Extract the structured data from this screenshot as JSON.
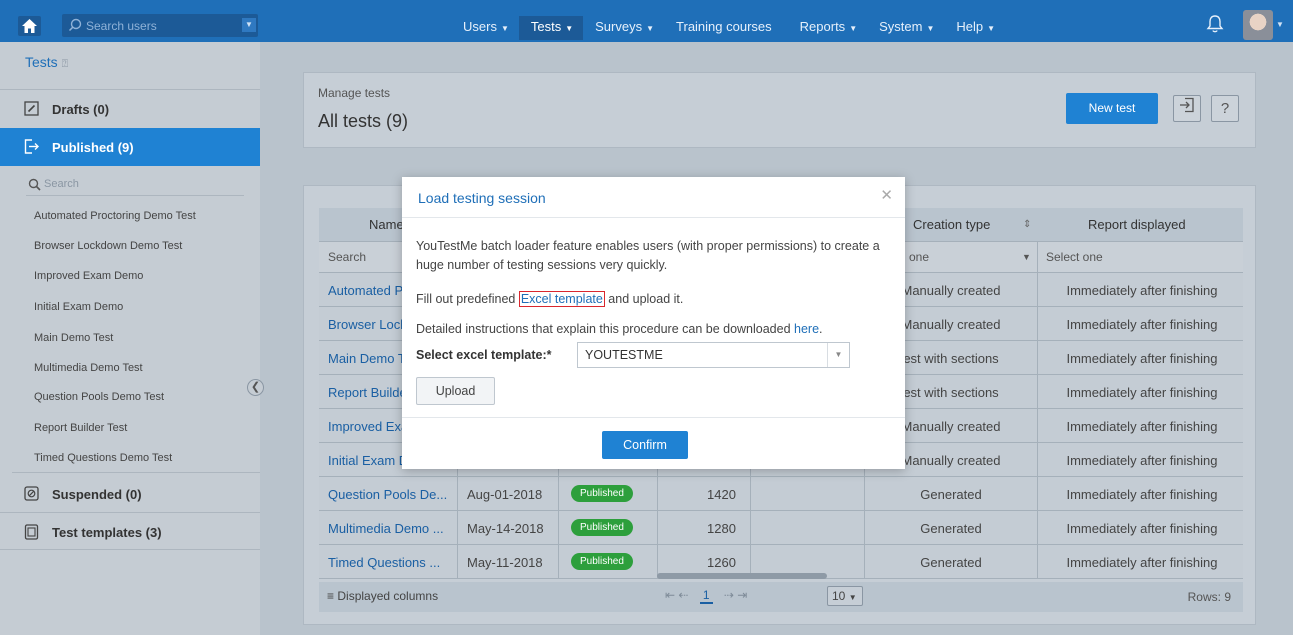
{
  "topbar": {
    "search_placeholder": "Search users",
    "nav": [
      {
        "label": "Users",
        "has_caret": true
      },
      {
        "label": "Tests",
        "has_caret": true,
        "active": true
      },
      {
        "label": "Surveys",
        "has_caret": true
      },
      {
        "label": "Training courses",
        "has_caret": false
      },
      {
        "label": "Reports",
        "has_caret": true
      },
      {
        "label": "System",
        "has_caret": true
      },
      {
        "label": "Help",
        "has_caret": true
      }
    ],
    "icons": {
      "home": "home-icon",
      "search": "search-icon",
      "notifications": "bell-icon",
      "avatar": "user-avatar"
    }
  },
  "sidebar": {
    "title": "Tests",
    "drafts": "Drafts (0)",
    "published": "Published (9)",
    "search_placeholder": "Search",
    "tests": [
      "Automated Proctoring Demo Test",
      "Browser Lockdown Demo Test",
      "Improved Exam Demo",
      "Initial Exam Demo",
      "Main Demo Test",
      "Multimedia Demo Test",
      "Question Pools Demo Test",
      "Report Builder Test",
      "Timed Questions Demo Test"
    ],
    "suspended": "Suspended (0)",
    "templates": "Test templates (3)"
  },
  "header": {
    "subtitle": "Manage tests",
    "title": "All tests (9)",
    "new_test": "New test",
    "help": "?"
  },
  "table": {
    "columns": [
      "Name",
      "Creation type",
      "Report displayed"
    ],
    "filters": {
      "name": "Search",
      "creation": "one",
      "report": "Select one"
    },
    "rows": [
      {
        "name": "Automated Pr",
        "date": "",
        "status": "",
        "id": "",
        "creation": "Manually created",
        "report": "Immediately after finishing"
      },
      {
        "name": "Browser Lock",
        "date": "",
        "status": "",
        "id": "",
        "creation": "Manually created",
        "report": "Immediately after finishing"
      },
      {
        "name": "Main Demo Te",
        "date": "",
        "status": "",
        "id": "",
        "creation": "est with sections",
        "report": "Immediately after finishing"
      },
      {
        "name": "Report Builde",
        "date": "",
        "status": "",
        "id": "",
        "creation": "est with sections",
        "report": "Immediately after finishing"
      },
      {
        "name": "Improved Exa",
        "date": "",
        "status": "",
        "id": "",
        "creation": "Manually created",
        "report": "Immediately after finishing"
      },
      {
        "name": "Initial Exam D",
        "date": "",
        "status": "",
        "id": "",
        "creation": "Manually created",
        "report": "Immediately after finishing"
      },
      {
        "name": "Question Pools De...",
        "date": "Aug-01-2018",
        "status": "Published",
        "id": "1420",
        "creation": "Generated",
        "report": "Immediately after finishing"
      },
      {
        "name": "Multimedia Demo ...",
        "date": "May-14-2018",
        "status": "Published",
        "id": "1280",
        "creation": "Generated",
        "report": "Immediately after finishing"
      },
      {
        "name": "Timed Questions ...",
        "date": "May-11-2018",
        "status": "Published",
        "id": "1260",
        "creation": "Generated",
        "report": "Immediately after finishing"
      }
    ],
    "footer": {
      "displayed_columns": "Displayed columns",
      "page": "1",
      "per_page": "10",
      "rows": "Rows: 9"
    }
  },
  "modal": {
    "title": "Load testing session",
    "para1": "YouTestMe batch loader feature enables users (with proper permissions) to create a huge number of testing sessions very quickly.",
    "fill_prefix": "Fill out predefined ",
    "fill_link": "Excel template",
    "fill_suffix": " and upload it.",
    "instr_prefix": "Detailed instructions that explain this procedure can be downloaded ",
    "instr_link": "here",
    "instr_suffix": ".",
    "select_label": "Select excel template:*",
    "select_value": "YOUTESTME",
    "upload": "Upload",
    "confirm": "Confirm"
  },
  "colors": {
    "accent": "#1f82d3",
    "topbar": "#1f6fb8",
    "published_badge": "#2d9f3c",
    "highlight_outline": "#d9272e"
  }
}
